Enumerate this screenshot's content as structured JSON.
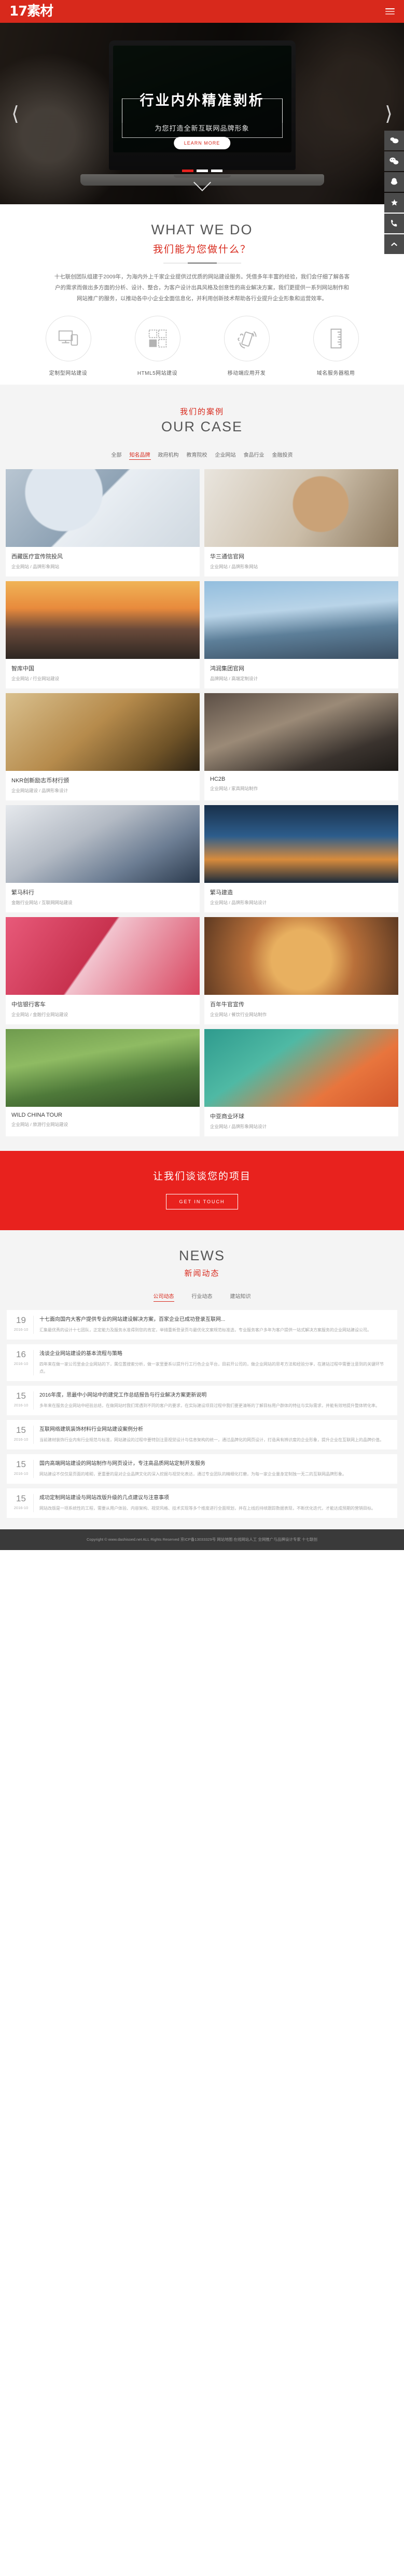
{
  "header": {
    "logo_text": "17素材",
    "menu_icon": "hamburger-icon"
  },
  "hero": {
    "title": "行业内外精准剥析",
    "subtitle": "为您打造全新互联网品牌形象",
    "button": "LEARN MORE",
    "prev_icon": "chevron-left-icon",
    "next_icon": "chevron-right-icon",
    "dots": 3,
    "active_dot": 0,
    "scroll_icon": "chevron-down-icon"
  },
  "floatbar": [
    {
      "name": "chat-icon"
    },
    {
      "name": "wechat-icon"
    },
    {
      "name": "qq-icon"
    },
    {
      "name": "weibo-icon"
    },
    {
      "name": "phone-icon"
    },
    {
      "name": "scroll-top-icon"
    }
  ],
  "what_we_do": {
    "title_en": "WHAT WE DO",
    "title_cn": "我们能为您做什么？",
    "paragraph": "十七联创团队组建于2009年，为海内外上千家企业提供过优质的网站建设服务。凭借多年丰富的经验，我们会仔细了解各客户的需求而做出多方面的分析、设计、整合，为客户设计出具风格及创意性的商业解决方案，我们更提供一系列网站制作和网站推广的服务，以推动各中小企业全面信息化，并利用创新技术帮助各行业提升企业形象和运营效率。",
    "services": [
      {
        "icon": "responsive-screens-icon",
        "label": "定制型网站建设"
      },
      {
        "icon": "grid-layout-icon",
        "label": "HTML5网站建设"
      },
      {
        "icon": "hand-mobile-icon",
        "label": "移动端应用开发"
      },
      {
        "icon": "ruler-icon",
        "label": "域名服务器租用"
      }
    ]
  },
  "our_case": {
    "title_cn": "我们的案例",
    "title_en": "OUR CASE",
    "tabs": [
      "全部",
      "知名品牌",
      "政府机构",
      "教育院校",
      "企业网站",
      "食品行业",
      "金融投资"
    ],
    "active_tab": 1,
    "cards": [
      {
        "name": "西藏医疗宣传院投风",
        "meta": "企业网站 / 品牌形象网站",
        "photo": "ph1"
      },
      {
        "name": "华三通信官网",
        "meta": "企业网站 / 品牌形象网站",
        "photo": "ph2"
      },
      {
        "name": "智库中国",
        "meta": "企业网站 / 行业网站建设",
        "photo": "ph3"
      },
      {
        "name": "鸿润集团官网",
        "meta": "品牌网站 / 高端定制设计",
        "photo": "ph4"
      },
      {
        "name": "NKR创新励志币材行颁",
        "meta": "企业网站建设 / 品牌形象设计",
        "photo": "ph5"
      },
      {
        "name": "HC2B",
        "meta": "企业网站 / 家具网站制作",
        "photo": "ph6"
      },
      {
        "name": "繁马科行",
        "meta": "金融行业网站 / 互联网网站建设",
        "photo": "ph7"
      },
      {
        "name": "繁马建造",
        "meta": "企业网站 / 品牌形象网站设计",
        "photo": "ph8"
      },
      {
        "name": "中信银行客车",
        "meta": "企业网站 / 金融行业网站建设",
        "photo": "ph9"
      },
      {
        "name": "百年牛官宣传",
        "meta": "企业网站 / 餐饮行业网站制作",
        "photo": "ph10"
      },
      {
        "name": "WILD CHINA TOUR",
        "meta": "企业网站 / 旅游行业网站建设",
        "photo": "ph11"
      },
      {
        "name": "中亚商业环球",
        "meta": "企业网站 / 品牌形象网站设计",
        "photo": "ph12"
      }
    ]
  },
  "cta": {
    "title": "让我们谈谈您的项目",
    "button": "GET IN TOUCH"
  },
  "news": {
    "title_en": "NEWS",
    "title_cn": "新闻动态",
    "tabs": [
      "公司动态",
      "行业动态",
      "建站知识"
    ],
    "active_tab": 0,
    "items": [
      {
        "day": "19",
        "monthyear": "2016-10",
        "title": "十七面向国内大客户提供专业的网站建设解决方案，百家企业已成功登录互联网...",
        "desc": "汇集最优秀的设计十七团队，正定能力及服务水准得到您的肯定，举措重新登录页与最优化文案规范标准选，专业服务客户多年为客户提供一站式解决方案服务的企业网站建设公司。"
      },
      {
        "day": "16",
        "monthyear": "2016-10",
        "title": "浅谈企业网站建设的基本流程与策略",
        "desc": "四年来在做一家公司里会企业网站的下，属位置搜索分析，做一家里要系以提升行工行色企业平台，目前开公司的，做企业网站的思考方法和经验分享，在建站过程中需要注意到的关键环节点。"
      },
      {
        "day": "15",
        "monthyear": "2016-10",
        "title": "2016年度，思最中小网站中的建党工作总结报告与行业解决方案更新说明",
        "desc": "多年来在服务企业网站中经验总结，在做网站时我们常遇到不同的客户的要求，在实际建设项目过程中我们要更清晰的了解目标用户群体的特征与实际需求，并能有效地提升整体转化率。"
      },
      {
        "day": "15",
        "monthyear": "2016-10",
        "title": "互联网络建筑装饰材料行业网站建设案例分析",
        "desc": "当前建材装饰行业内有行业规范与标准，网站建设的过程中要特别注意视觉设计与信息架构的统一，通过品牌化的网页设计，打造具有辨识度的企业形象，提升企业在互联网上的品牌价值。"
      },
      {
        "day": "15",
        "monthyear": "2016-10",
        "title": "国内高端网站建设的网站制作与网页设计，专注高品质网站定制开发服务",
        "desc": "网站建设不仅仅是页面的堆砌，更重要的是对企业品牌文化的深入挖掘与视觉化表达，通过专业团队的精细化打磨，为每一家企业量身定制独一无二的互联网品牌形象。"
      },
      {
        "day": "15",
        "monthyear": "2016-10",
        "title": "成功定制网站建设与网站改版升级的几点建议与注意事项",
        "desc": "网站改版是一项系统性的工程，需要从用户体验、内容架构、视觉风格、技术实现等多个维度进行全面规划，并在上线后持续跟踪数据表现，不断优化迭代，才能达成预期的营销目标。"
      }
    ]
  },
  "footer": {
    "text": "Copyright © www.dashisoed.net ALL Rights Reserved 京ICP备13033329号   网站地图  在线网站人工 全网推广与品牌设计专家 十七联创"
  }
}
